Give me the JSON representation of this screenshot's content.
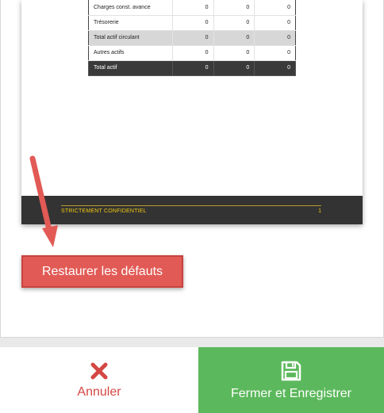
{
  "preview_table": {
    "rows": [
      {
        "label": "Charges const. avance",
        "values": [
          "0",
          "0",
          "0"
        ],
        "style": "normal"
      },
      {
        "label": "Trésorerie",
        "values": [
          "0",
          "0",
          "0"
        ],
        "style": "normal"
      },
      {
        "label": "Total actif circulant",
        "values": [
          "0",
          "0",
          "0"
        ],
        "style": "highlight"
      },
      {
        "label": "Autres actifs",
        "values": [
          "0",
          "0",
          "0"
        ],
        "style": "normal"
      },
      {
        "label": "Total actif",
        "values": [
          "0",
          "0",
          "0"
        ],
        "style": "dark"
      }
    ]
  },
  "page_footer": {
    "text": "STRICTEMENT CONFIDENTIEL",
    "page_number": "1"
  },
  "restore_button": {
    "label": "Restaurer les défauts"
  },
  "actions": {
    "cancel_label": "Annuler",
    "save_label": "Fermer et Enregistrer"
  },
  "colors": {
    "accent_red": "#e25a55",
    "cancel_red": "#d44743",
    "save_green": "#5cb85c",
    "footer_yellow": "#f2c811",
    "footer_dark": "#333333"
  },
  "icons": {
    "cancel": "close-icon",
    "save": "floppy-disk-icon",
    "annotation": "arrow-icon"
  }
}
